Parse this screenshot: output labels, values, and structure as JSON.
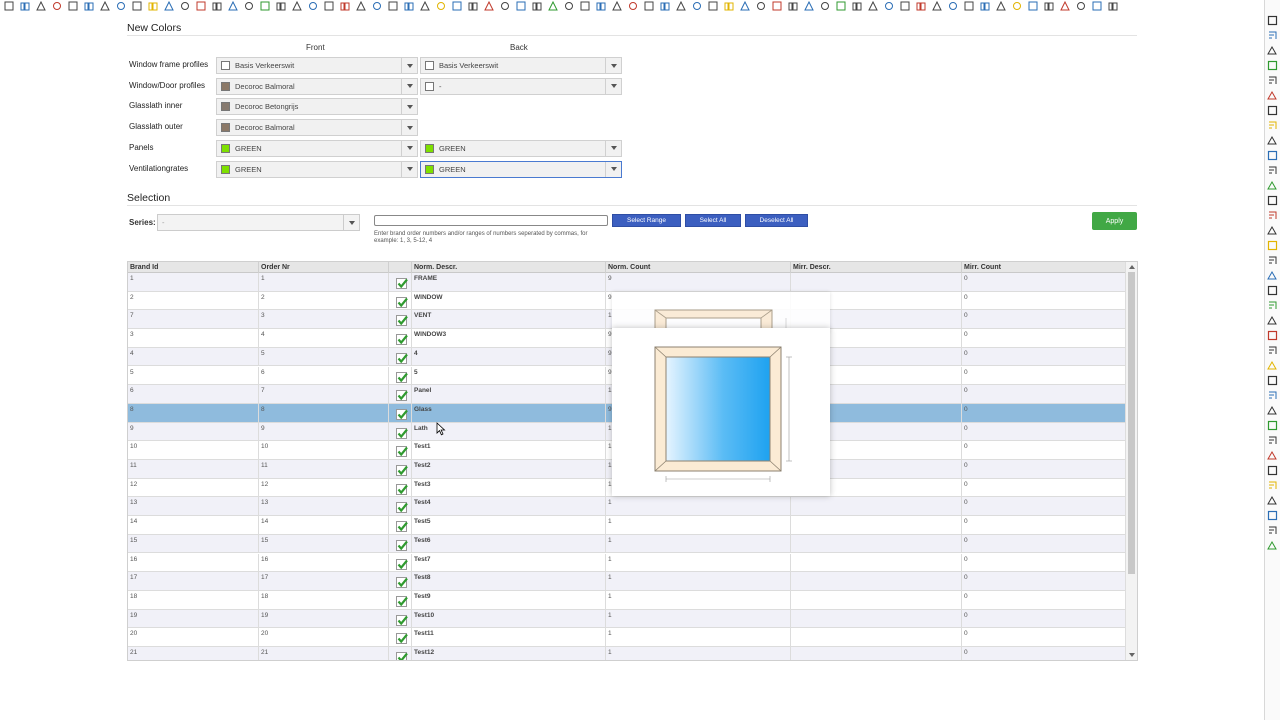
{
  "new_colors": {
    "title": "New Colors",
    "front_header": "Front",
    "back_header": "Back",
    "rows": [
      {
        "label": "Window frame profiles",
        "front": {
          "name": "Basis Verkeerswit",
          "color": "#ffffff"
        },
        "back": {
          "name": "Basis Verkeerswit",
          "color": "#ffffff"
        }
      },
      {
        "label": "Window/Door profiles",
        "front": {
          "name": "Decoroc Balmoral",
          "color": "#8b7867"
        },
        "back": {
          "name": "-",
          "color": "#ffffff"
        }
      },
      {
        "label": "Glasslath inner",
        "front": {
          "name": "Decoroc Betongrijs",
          "color": "#877a6f"
        },
        "back": null
      },
      {
        "label": "Glasslath outer",
        "front": {
          "name": "Decoroc Balmoral",
          "color": "#8b7867"
        },
        "back": null
      },
      {
        "label": "Panels",
        "front": {
          "name": "GREEN",
          "color": "#7ee000"
        },
        "back": {
          "name": "GREEN",
          "color": "#7ee000"
        }
      },
      {
        "label": "Ventilationgrates",
        "front": {
          "name": "GREEN",
          "color": "#7ee000"
        },
        "back": {
          "name": "GREEN",
          "color": "#7ee000"
        }
      }
    ]
  },
  "selection": {
    "title": "Selection",
    "series_label": "Series:",
    "series_value": "-",
    "range_input_value": "",
    "range_hint": "Enter brand order numbers and/or ranges of numbers seperated by commas, for example: 1, 3, 5-12, 4",
    "select_range_label": "Select Range",
    "select_all_label": "Select All",
    "deselect_all_label": "Deselect All",
    "apply_label": "Apply"
  },
  "table": {
    "columns": [
      "Brand Id",
      "Order Nr",
      "",
      "Norm. Descr.",
      "Norm. Count",
      "Mirr. Descr.",
      "Mirr. Count"
    ],
    "rows": [
      [
        "1",
        "1",
        "FRAME",
        "9",
        "",
        "0"
      ],
      [
        "2",
        "2",
        "WINDOW",
        "9",
        "",
        "0"
      ],
      [
        "7",
        "3",
        "VENT",
        "1",
        "",
        "0"
      ],
      [
        "3",
        "4",
        "WINDOW3",
        "9",
        "",
        "0"
      ],
      [
        "4",
        "5",
        "4",
        "9",
        "",
        "0"
      ],
      [
        "5",
        "6",
        "5",
        "9",
        "",
        "0"
      ],
      [
        "6",
        "7",
        "Panel",
        "1",
        "",
        "0"
      ],
      [
        "8",
        "8",
        "Glass",
        "9",
        "",
        "0"
      ],
      [
        "9",
        "9",
        "Lath",
        "1",
        "",
        "0"
      ],
      [
        "10",
        "10",
        "Test1",
        "1",
        "",
        "0"
      ],
      [
        "11",
        "11",
        "Test2",
        "1",
        "",
        "0"
      ],
      [
        "12",
        "12",
        "Test3",
        "1",
        "",
        "0"
      ],
      [
        "13",
        "13",
        "Test4",
        "1",
        "",
        "0"
      ],
      [
        "14",
        "14",
        "Test5",
        "1",
        "",
        "0"
      ],
      [
        "15",
        "15",
        "Test6",
        "1",
        "",
        "0"
      ],
      [
        "16",
        "16",
        "Test7",
        "1",
        "",
        "0"
      ],
      [
        "17",
        "17",
        "Test8",
        "1",
        "",
        "0"
      ],
      [
        "18",
        "18",
        "Test9",
        "1",
        "",
        "0"
      ],
      [
        "19",
        "19",
        "Test10",
        "1",
        "",
        "0"
      ],
      [
        "20",
        "20",
        "Test11",
        "1",
        "",
        "0"
      ],
      [
        "21",
        "21",
        "Test12",
        "1",
        "",
        "0"
      ]
    ],
    "selected_row": 7
  },
  "colors": {
    "button_blue": "#3c5fc0",
    "apply_green": "#41a845",
    "selected_row": "#8fbbdd",
    "check_green": "#2f9a2f"
  }
}
